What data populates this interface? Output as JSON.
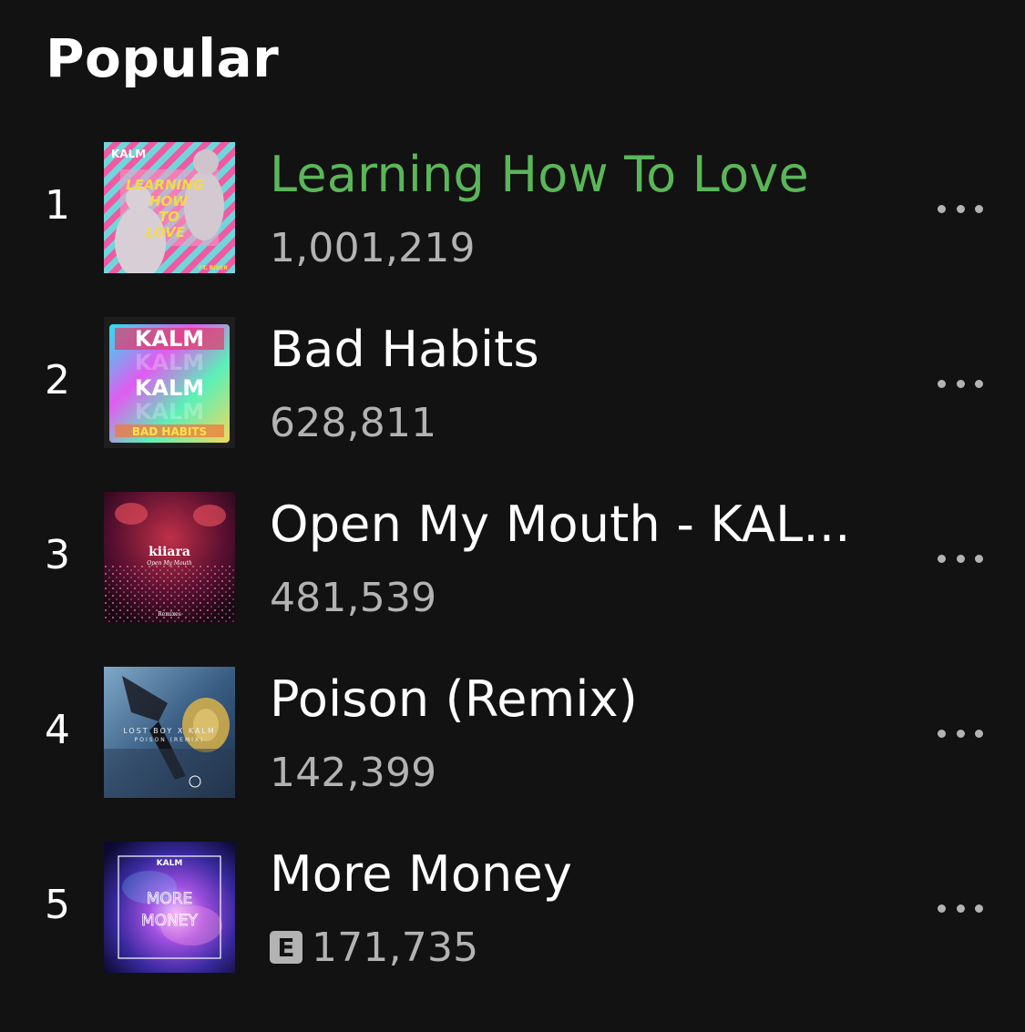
{
  "section": {
    "title": "Popular"
  },
  "tracks": [
    {
      "rank": "1",
      "title": "Learning How To Love",
      "plays": "1,001,219",
      "playing": true,
      "explicit": false,
      "art_text": {
        "brand": "KALM",
        "line1": "LEARNING",
        "line2": "HOW",
        "line3": "TO",
        "line4": "LOVE",
        "credit": "FT. RIVER"
      }
    },
    {
      "rank": "2",
      "title": "Bad Habits",
      "plays": "628,811",
      "playing": false,
      "explicit": false,
      "art_text": {
        "line1": "KALM",
        "line2": "KALM",
        "line3": "KALM",
        "line4": "KALM",
        "line5": "BAD HABITS"
      }
    },
    {
      "rank": "3",
      "title": "Open My Mouth - KAL...",
      "plays": "481,539",
      "playing": false,
      "explicit": false,
      "art_text": {
        "artist": "kiiara",
        "subtitle": "Open My Mouth",
        "footer": "Remixes"
      }
    },
    {
      "rank": "4",
      "title": "Poison (Remix)",
      "plays": "142,399",
      "playing": false,
      "explicit": false,
      "art_text": {
        "line1": "LOST BOY X KALM",
        "line2": "POISON (REMIX)"
      }
    },
    {
      "rank": "5",
      "title": "More Money",
      "plays": "171,735",
      "playing": false,
      "explicit": true,
      "explicit_label": "E",
      "art_text": {
        "brand": "KALM",
        "line1": "MORE",
        "line2": "MONEY"
      }
    }
  ],
  "colors": {
    "background": "#121212",
    "accent_playing": "#5bb659",
    "secondary_text": "#b3b3b3"
  },
  "icons": {
    "more": "more-options-icon",
    "explicit": "explicit-badge"
  }
}
